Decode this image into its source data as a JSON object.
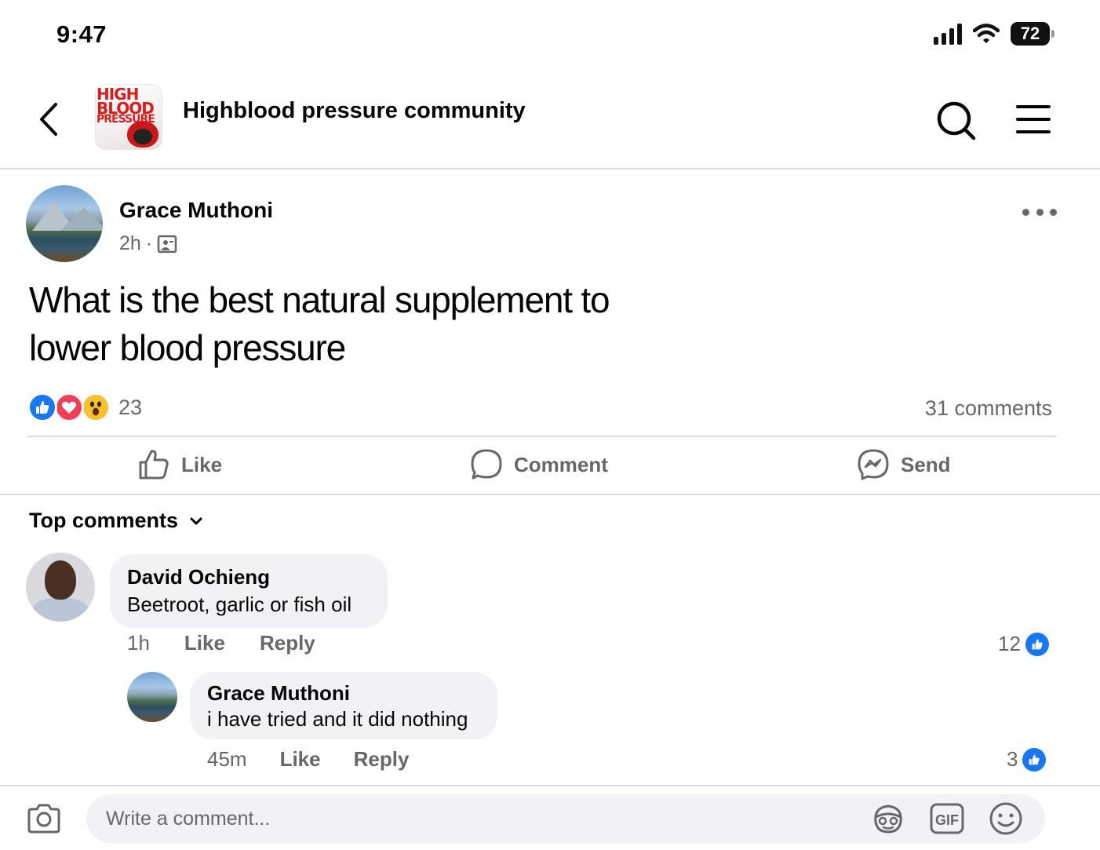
{
  "status_bar": {
    "time": "9:47",
    "battery": "72"
  },
  "header": {
    "logo_lines": [
      "HIGH",
      "BLOOD",
      "PRESSURE"
    ],
    "group_name": "Highblood pressure community"
  },
  "post": {
    "author": "Grace Muthoni",
    "time": "2h",
    "separator": "·",
    "text": "What is the best natural supplement to lower blood pressure",
    "reaction_count": "23",
    "comments_count": "31 comments"
  },
  "actions": {
    "like": "Like",
    "comment": "Comment",
    "send": "Send"
  },
  "comments_section": {
    "sort_label": "Top comments",
    "comments": [
      {
        "author": "David Ochieng",
        "text": "Beetroot, garlic or fish oil",
        "time": "1h",
        "like": "Like",
        "reply": "Reply",
        "likes": "12"
      },
      {
        "author": "Grace Muthoni",
        "text": "i have tried and it did nothing",
        "time": "45m",
        "like": "Like",
        "reply": "Reply",
        "likes": "3"
      }
    ]
  },
  "composer": {
    "placeholder": "Write a comment...",
    "gif_label": "GIF"
  },
  "colors": {
    "accent": "#1877f2",
    "love": "#f33e58",
    "wow": "#f7c22e",
    "secondary_text": "#65676b",
    "bubble": "#f0f2f5"
  }
}
